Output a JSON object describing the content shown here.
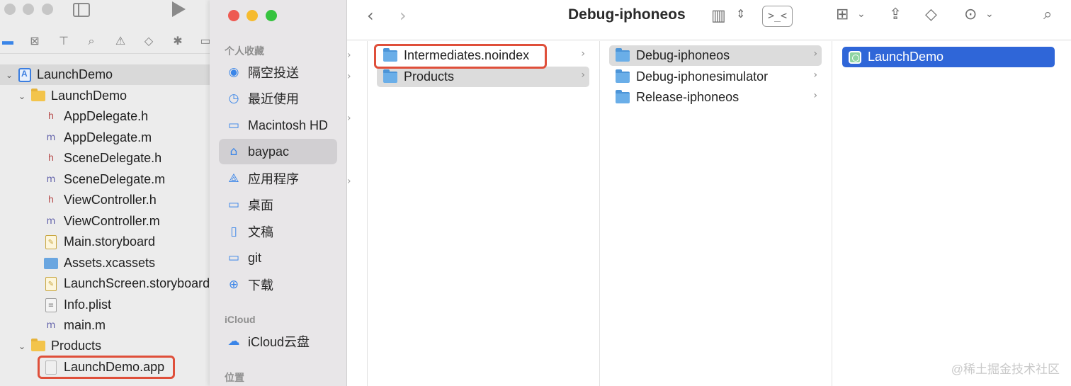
{
  "xcode": {
    "icons": [
      "sidebar-toggle-icon",
      "run-icon",
      "folder-icon",
      "issue-icon",
      "hierarchy-icon",
      "search-icon",
      "warning-icon",
      "test-icon",
      "debug-icon",
      "report-icon"
    ],
    "tree": [
      {
        "label": "LaunchDemo",
        "kind": "project"
      },
      {
        "label": "LaunchDemo",
        "kind": "group"
      },
      {
        "label": "AppDelegate.h",
        "kind": "h",
        "badge": "h"
      },
      {
        "label": "AppDelegate.m",
        "kind": "m",
        "badge": "m"
      },
      {
        "label": "SceneDelegate.h",
        "kind": "h",
        "badge": "h"
      },
      {
        "label": "SceneDelegate.m",
        "kind": "m",
        "badge": "m"
      },
      {
        "label": "ViewController.h",
        "kind": "h",
        "badge": "h"
      },
      {
        "label": "ViewController.m",
        "kind": "m",
        "badge": "m"
      },
      {
        "label": "Main.storyboard",
        "kind": "storyboard"
      },
      {
        "label": "Assets.xcassets",
        "kind": "assets"
      },
      {
        "label": "LaunchScreen.storyboard",
        "kind": "storyboard"
      },
      {
        "label": "Info.plist",
        "kind": "plist"
      },
      {
        "label": "main.m",
        "kind": "m",
        "badge": "m"
      },
      {
        "label": "Products",
        "kind": "group"
      },
      {
        "label": "LaunchDemo.app",
        "kind": "app"
      }
    ]
  },
  "finder": {
    "traffic_colors": [
      "#ee5a52",
      "#f6bb2f",
      "#36c33f"
    ],
    "sidebar": {
      "favorites_header": "个人收藏",
      "favorites": [
        {
          "label": "隔空投送",
          "icon": "airdrop-icon"
        },
        {
          "label": "最近使用",
          "icon": "clock-icon"
        },
        {
          "label": "Macintosh HD",
          "icon": "disk-icon"
        },
        {
          "label": "baypac",
          "icon": "home-icon",
          "active": true
        },
        {
          "label": "应用程序",
          "icon": "apps-icon"
        },
        {
          "label": "桌面",
          "icon": "desktop-icon"
        },
        {
          "label": "文稿",
          "icon": "document-icon"
        },
        {
          "label": "git",
          "icon": "folder-icon"
        },
        {
          "label": "下载",
          "icon": "download-icon"
        }
      ],
      "icloud_header": "iCloud",
      "icloud": [
        {
          "label": "iCloud云盘",
          "icon": "cloud-icon"
        }
      ],
      "locations_header": "位置"
    },
    "toolbar": {
      "title": "Debug-iphoneos",
      "icons": [
        "back-icon",
        "forward-icon",
        "column-view-icon",
        "sort-chevron-icon",
        "terminal-icon",
        "group-view-icon",
        "share-icon",
        "tag-icon",
        "more-icon",
        "search-icon"
      ]
    },
    "columns": [
      {
        "rows": [
          {
            "label": "Intermediates.noindex",
            "state": "none"
          },
          {
            "label": "Products",
            "state": "grey"
          }
        ]
      },
      {
        "rows": [
          {
            "label": "Debug-iphoneos",
            "state": "grey"
          },
          {
            "label": "Debug-iphonesimulator",
            "state": "none"
          },
          {
            "label": "Release-iphoneos",
            "state": "none"
          }
        ]
      },
      {
        "rows": [
          {
            "label": "LaunchDemo",
            "state": "blue"
          }
        ]
      }
    ]
  },
  "watermark": "@稀土掘金技术社区"
}
